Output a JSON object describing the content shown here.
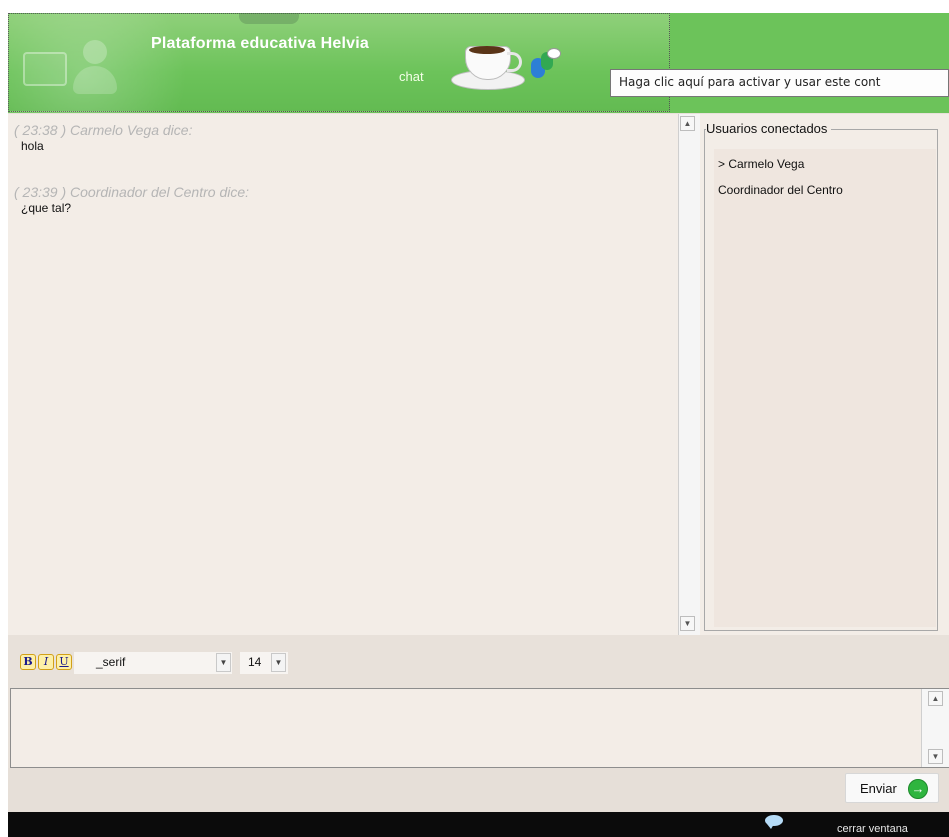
{
  "header": {
    "title": "Plataforma educativa Helvia",
    "subtitle": "chat",
    "tooltip": "Haga clic aquí para activar y usar este cont"
  },
  "chat": {
    "messages": [
      {
        "meta": "( 23:38 ) Carmelo Vega dice:",
        "text": "hola"
      },
      {
        "meta": "( 23:39 ) Coordinador del Centro dice:",
        "text": "¿que tal?"
      }
    ]
  },
  "users": {
    "legend": "Usuarios conectados",
    "items": [
      "> Carmelo Vega",
      "Coordinador del Centro"
    ]
  },
  "toolbar": {
    "bold_label": "B",
    "italic_label": "I",
    "underline_label": "U",
    "font_value": "_serif",
    "size_value": "14"
  },
  "input": {
    "value": ""
  },
  "send": {
    "label": "Enviar"
  },
  "footer": {
    "close_label": "cerrar ventana"
  },
  "colors": {
    "header_green": "#6cc35a",
    "panel_bg": "#f3ede7",
    "meta_gray": "#b5b5b5",
    "footer_bg": "#0b0b0b",
    "send_green": "#2fb53f"
  },
  "icons": [
    "laptop-icon",
    "user-silhouette-icon",
    "coffee-cup-icon",
    "messenger-icon",
    "arrow-right-icon",
    "speech-bubble-icon"
  ]
}
